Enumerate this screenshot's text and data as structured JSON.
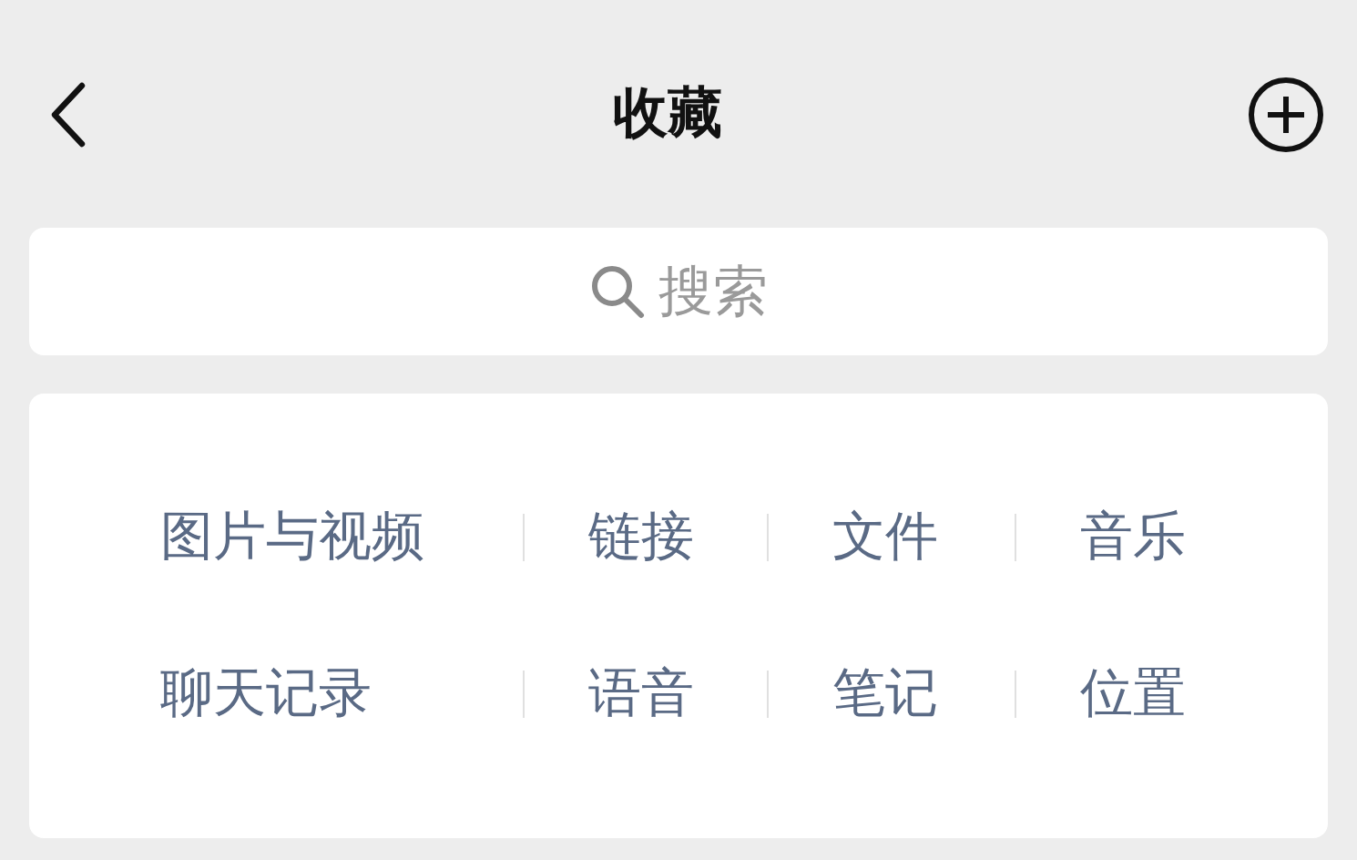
{
  "header": {
    "title": "收藏"
  },
  "search": {
    "placeholder": "搜索"
  },
  "categories": [
    [
      "图片与视频",
      "链接",
      "文件",
      "音乐"
    ],
    [
      "聊天记录",
      "语音",
      "笔记",
      "位置"
    ]
  ]
}
